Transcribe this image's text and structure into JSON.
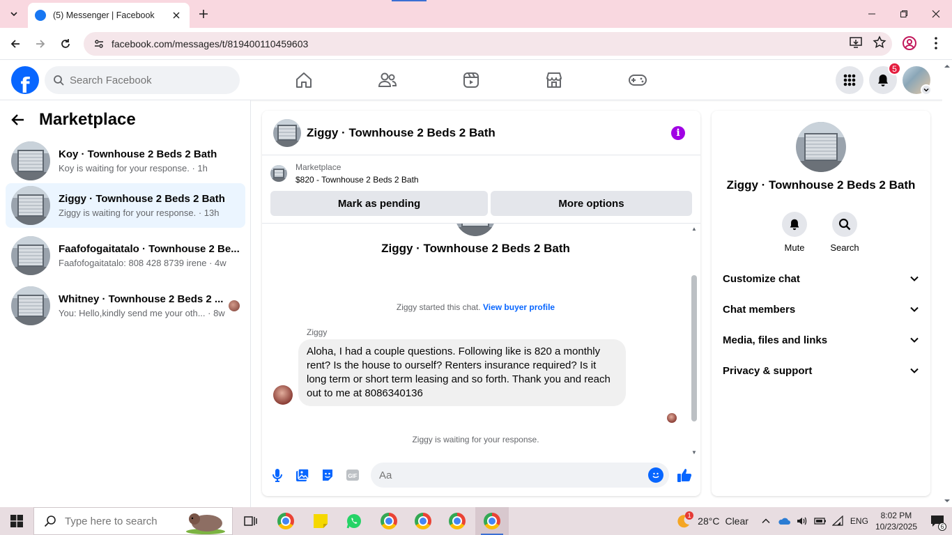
{
  "browser": {
    "tab_title": "(5) Messenger | Facebook",
    "url": "facebook.com/messages/t/819400110459603"
  },
  "fb_header": {
    "search_placeholder": "Search Facebook",
    "notification_count": "5",
    "logo_letter": "f"
  },
  "sidebar": {
    "title": "Marketplace",
    "conversations": [
      {
        "name": "Koy · Townhouse 2 Beds 2 Bath",
        "snippet": "Koy is waiting for your response. · 1h",
        "active": false
      },
      {
        "name": "Ziggy · Townhouse 2 Beds 2 Bath",
        "snippet": "Ziggy is waiting for your response. · 13h",
        "active": true
      },
      {
        "name": "Faafofogaitatalo · Townhouse 2 Be...",
        "snippet": "Faafofogaitatalo: 808 428 8739 irene · 4w",
        "active": false
      },
      {
        "name": "Whitney · Townhouse 2 Beds 2 ...",
        "snippet": "You: Hello,kindly send me your oth... · 8w",
        "active": false
      }
    ]
  },
  "chat": {
    "title": "Ziggy · Townhouse 2 Beds 2 Bath",
    "marketplace_label": "Marketplace",
    "listing": "$820 - Townhouse 2 Beds 2 Bath",
    "mark_pending": "Mark as pending",
    "more_options": "More options",
    "conversation_title": "Ziggy · Townhouse 2 Beds 2 Bath",
    "started_text": "Ziggy started this chat.",
    "view_buyer_profile": "View buyer profile",
    "sender": "Ziggy",
    "message": "Aloha, I had a couple questions. Following like is 820 a monthly rent? Is the house to ourself? Renters insurance required? Is it long term or short term leasing and so forth. Thank you and reach out to me at 8086340136",
    "waiting_text": "Ziggy is waiting for your response.",
    "composer_placeholder": "Aa"
  },
  "details": {
    "name": "Ziggy · Townhouse 2 Beds 2 Bath",
    "mute_label": "Mute",
    "search_label": "Search",
    "sections": [
      "Customize chat",
      "Chat members",
      "Media, files and links",
      "Privacy & support"
    ]
  },
  "taskbar": {
    "search_placeholder": "Type here to search",
    "weather_temp": "28°C",
    "weather_desc": "Clear",
    "weather_badge": "1",
    "language": "ENG",
    "time": "8:02 PM",
    "date": "10/23/2025",
    "notif_count": "6"
  },
  "colors": {
    "fb_blue": "#0866ff",
    "messenger_purple": "#a000e4",
    "active_convo": "#ebf5ff",
    "notification_red": "#e41e3f"
  }
}
